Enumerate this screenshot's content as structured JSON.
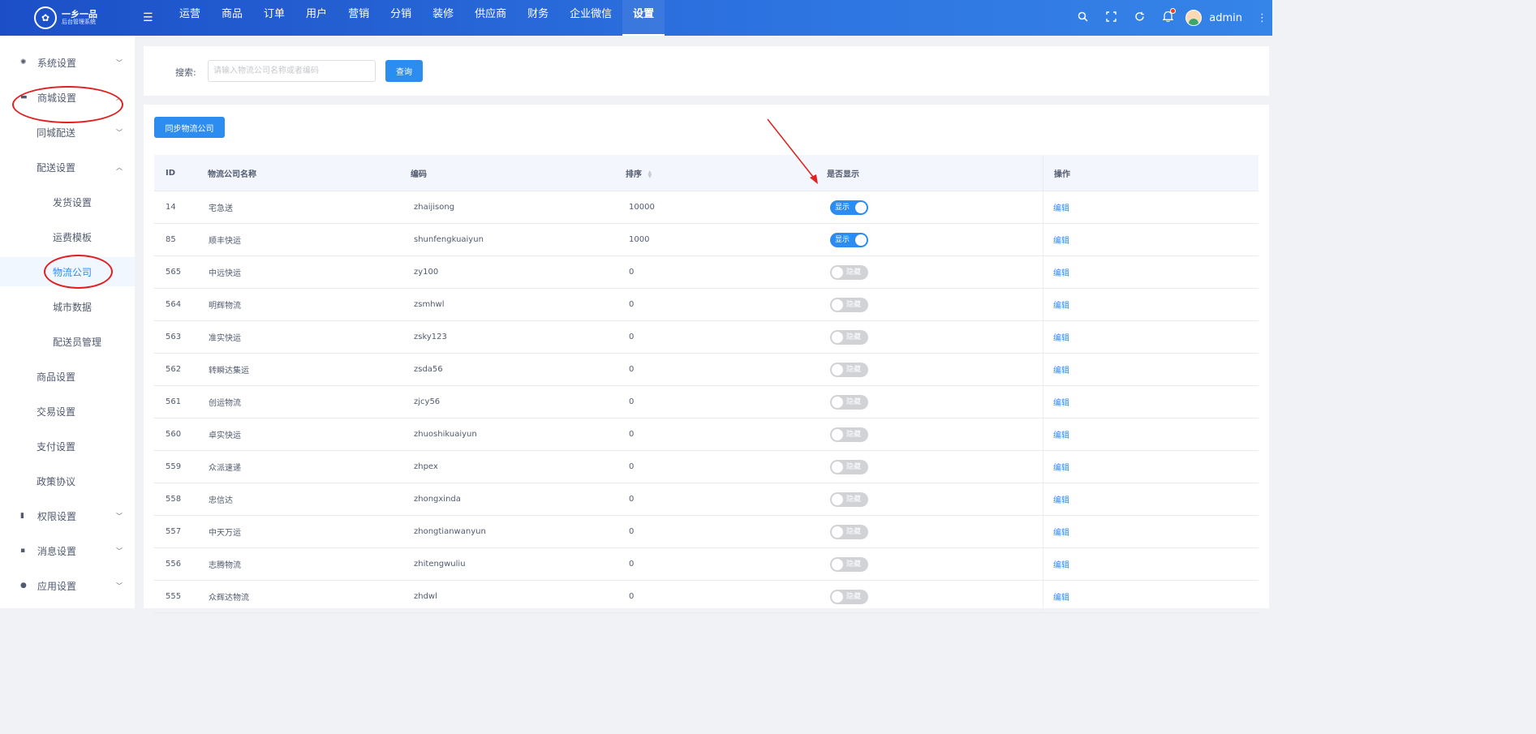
{
  "header": {
    "logo_title": "一乡一品",
    "logo_subtitle": "后台管理系统",
    "nav": [
      {
        "label": "运营",
        "active": false
      },
      {
        "label": "商品",
        "active": false
      },
      {
        "label": "订单",
        "active": false
      },
      {
        "label": "用户",
        "active": false
      },
      {
        "label": "营销",
        "active": false
      },
      {
        "label": "分销",
        "active": false
      },
      {
        "label": "装修",
        "active": false
      },
      {
        "label": "供应商",
        "active": false
      },
      {
        "label": "财务",
        "active": false
      },
      {
        "label": "企业微信",
        "active": false
      },
      {
        "label": "设置",
        "active": true
      }
    ],
    "username": "admin",
    "icons": [
      "search-icon",
      "fullscreen-icon",
      "refresh-icon",
      "bell-icon",
      "more-icon"
    ],
    "colors": {
      "primary": "#2d8cf0",
      "header_start": "#1c4fc7",
      "header_end": "#3584e8",
      "annotation": "#e02020"
    }
  },
  "sidebar": {
    "items": [
      {
        "label": "系统设置",
        "level": 0,
        "icon": "gear-icon",
        "expanded": false
      },
      {
        "label": "商城设置",
        "level": 0,
        "icon": "shop-icon",
        "expanded": true
      },
      {
        "label": "同城配送",
        "level": 1,
        "expanded": false
      },
      {
        "label": "配送设置",
        "level": 1,
        "expanded": true
      },
      {
        "label": "发货设置",
        "level": 2
      },
      {
        "label": "运费模板",
        "level": 2
      },
      {
        "label": "物流公司",
        "level": 2,
        "active": true
      },
      {
        "label": "城市数据",
        "level": 2
      },
      {
        "label": "配送员管理",
        "level": 2
      },
      {
        "label": "商品设置",
        "level": 1
      },
      {
        "label": "交易设置",
        "level": 1
      },
      {
        "label": "支付设置",
        "level": 1
      },
      {
        "label": "政策协议",
        "level": 1
      },
      {
        "label": "权限设置",
        "level": 0,
        "icon": "bookmark-icon",
        "expanded": false
      },
      {
        "label": "消息设置",
        "level": 0,
        "icon": "message-icon",
        "expanded": false
      },
      {
        "label": "应用设置",
        "level": 0,
        "icon": "app-icon",
        "expanded": false
      }
    ]
  },
  "search": {
    "label": "搜索:",
    "placeholder": "请输入物流公司名称或者编码",
    "value": "",
    "button": "查询"
  },
  "actions": {
    "sync_button": "同步物流公司"
  },
  "table": {
    "columns": [
      "ID",
      "物流公司名称",
      "编码",
      "排序",
      "是否显示",
      "操作"
    ],
    "rows": [
      {
        "id": "14",
        "name": "宅急送",
        "code": "zhaijisong",
        "sort": "10000",
        "show": true,
        "op": "编辑"
      },
      {
        "id": "85",
        "name": "顺丰快运",
        "code": "shunfengkuaiyun",
        "sort": "1000",
        "show": true,
        "op": "编辑"
      },
      {
        "id": "565",
        "name": "中远快运",
        "code": "zy100",
        "sort": "0",
        "show": false,
        "op": "编辑"
      },
      {
        "id": "564",
        "name": "明辉物流",
        "code": "zsmhwl",
        "sort": "0",
        "show": false,
        "op": "编辑"
      },
      {
        "id": "563",
        "name": "准实快运",
        "code": "zsky123",
        "sort": "0",
        "show": false,
        "op": "编辑"
      },
      {
        "id": "562",
        "name": "转瞬达集运",
        "code": "zsda56",
        "sort": "0",
        "show": false,
        "op": "编辑"
      },
      {
        "id": "561",
        "name": "创运物流",
        "code": "zjcy56",
        "sort": "0",
        "show": false,
        "op": "编辑"
      },
      {
        "id": "560",
        "name": "卓实快运",
        "code": "zhuoshikuaiyun",
        "sort": "0",
        "show": false,
        "op": "编辑"
      },
      {
        "id": "559",
        "name": "众派速递",
        "code": "zhpex",
        "sort": "0",
        "show": false,
        "op": "编辑"
      },
      {
        "id": "558",
        "name": "忠信达",
        "code": "zhongxinda",
        "sort": "0",
        "show": false,
        "op": "编辑"
      },
      {
        "id": "557",
        "name": "中天万运",
        "code": "zhongtianwanyun",
        "sort": "0",
        "show": false,
        "op": "编辑"
      },
      {
        "id": "556",
        "name": "志腾物流",
        "code": "zhitengwuliu",
        "sort": "0",
        "show": false,
        "op": "编辑"
      },
      {
        "id": "555",
        "name": "众辉达物流",
        "code": "zhdwl",
        "sort": "0",
        "show": false,
        "op": "编辑"
      }
    ],
    "switch_on_label": "显示",
    "switch_off_label": "隐藏"
  }
}
